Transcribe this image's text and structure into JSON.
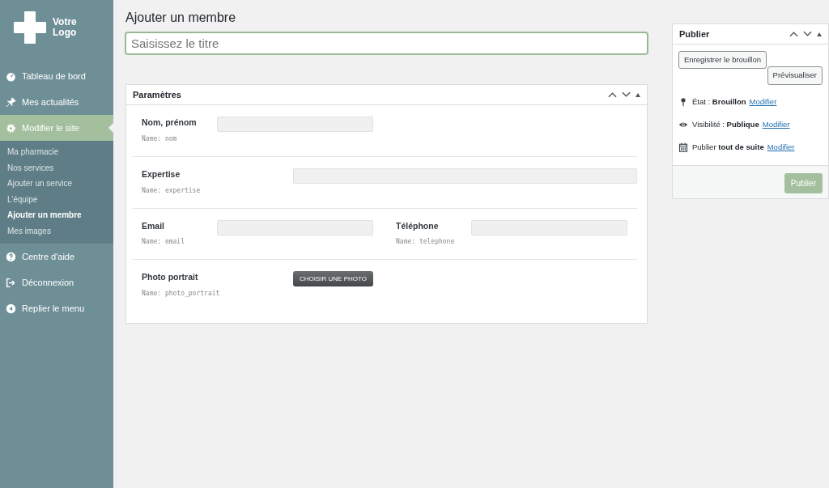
{
  "logo": {
    "text_line_1": "Votre",
    "text_line_2": "Logo"
  },
  "sidebar": {
    "items": [
      {
        "label": "Tableau de bord",
        "kind": "gauge",
        "selected": false
      },
      {
        "label": "Mes actualités",
        "kind": "pin",
        "selected": false
      },
      {
        "label": "Modifier le site",
        "kind": "gear",
        "selected": true,
        "children": [
          {
            "label": "Ma pharmacie",
            "selected": false
          },
          {
            "label": "Nos services",
            "selected": false
          },
          {
            "label": "Ajouter un service",
            "selected": false
          },
          {
            "label": "L’équipe",
            "selected": false
          },
          {
            "label": "Ajouter un membre",
            "selected": true
          },
          {
            "label": "Mes images",
            "selected": false
          }
        ]
      },
      {
        "label": "Centre d'aide",
        "kind": "help",
        "selected": false
      },
      {
        "label": "Déconnexion",
        "kind": "logout",
        "selected": false
      },
      {
        "label": "Replier le menu",
        "kind": "collapse",
        "selected": false
      }
    ]
  },
  "page_title": "Ajouter un membre",
  "title_field": {
    "placeholder": "Saisissez le titre"
  },
  "parameters": {
    "title": "Paramètres",
    "rows": [
      {
        "fields": [
          {
            "kind": "short",
            "label": "Nom, prénom",
            "name": "Name: nom"
          }
        ]
      },
      {
        "fields": [
          {
            "kind": "long",
            "label": "Expertise",
            "name": "Name: expertise"
          }
        ]
      },
      {
        "fields": [
          {
            "kind": "short",
            "label": "Email",
            "name": "Name: email"
          },
          {
            "kind": "short",
            "label": "Téléphone",
            "name": "Name: telephone"
          }
        ]
      },
      {
        "fields": [
          {
            "kind": "button",
            "label": "Photo portrait",
            "name": "Name: photo_portrait",
            "button": "CHOISIR UNE PHOTO"
          }
        ]
      }
    ]
  },
  "publish": {
    "title": "Publier",
    "save_draft": "Enregistrer le brouillon",
    "preview": "Prévisualiser",
    "meta": [
      {
        "kind": "status",
        "text": "État : **Brouillon**",
        "link": "Modifier"
      },
      {
        "kind": "visibility",
        "text": "Visibilité : **Publique**",
        "link": "Modifier"
      },
      {
        "kind": "schedule",
        "text": "Publier **tout de suite**",
        "link": "Modifier"
      }
    ],
    "publish_button": "Publier"
  }
}
